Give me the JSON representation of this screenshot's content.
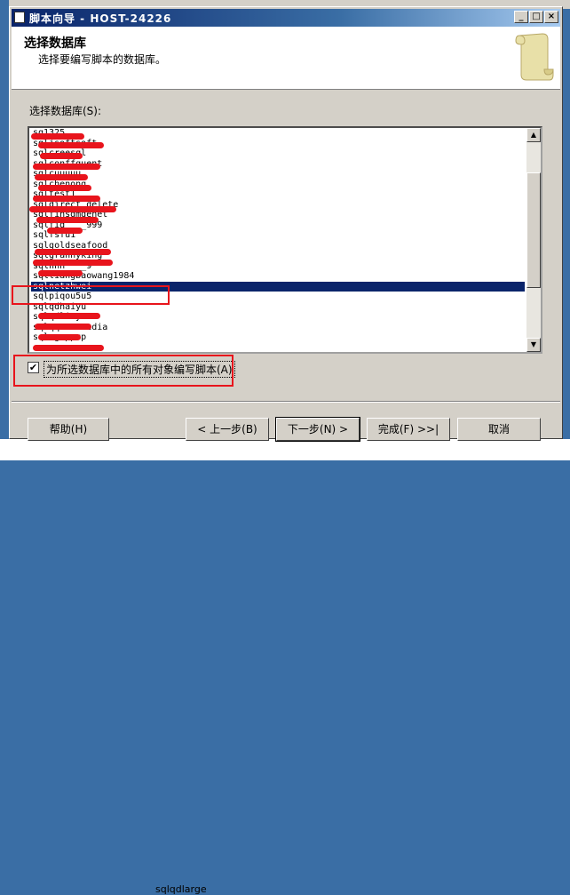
{
  "window": {
    "title": "脚本向导 - HOST-24226",
    "minimize": "_",
    "maximize": "□",
    "close": "×"
  },
  "header": {
    "title": "选择数据库",
    "subtitle": "选择要编写脚本的数据库。"
  },
  "list": {
    "label": "选择数据库(S):",
    "items": [
      "sq1325",
      "sqljsoftsoft",
      "sqlcreesql",
      "sqlconffquent",
      "sqlcuuuuu",
      "sqlchenong",
      "sqltest1",
      "sqldirect_delete",
      "sqlfinsgmgenet",
      "sqlfig____999",
      "sqlfsfu1",
      "sqlgoldseafood",
      "sqlgrannyking",
      "sqlhhh____9",
      "sqlliangbaowang1984",
      "sqlnetzhwei",
      "sqlpiqou5u5",
      "sqlqdhaiyu",
      "sqlqdlinyu",
      "sqlqqueenmedia",
      "sqlsguppup"
    ],
    "selected": "sqlnetzhwei"
  },
  "checkbox": {
    "label": "为所选数据库中的所有对象编写脚本(A)",
    "checked": "✔"
  },
  "buttons": {
    "help": "帮助(H)",
    "back": "< 上一步(B)",
    "next": "下一步(N) >",
    "finish": "完成(F) >>|",
    "cancel": "取消"
  },
  "background": {
    "bottom_text": "sqlqdlarge"
  },
  "colors": {
    "selection": "#0a246a",
    "annotation": "#e8141c",
    "window": "#d4d0c8"
  }
}
